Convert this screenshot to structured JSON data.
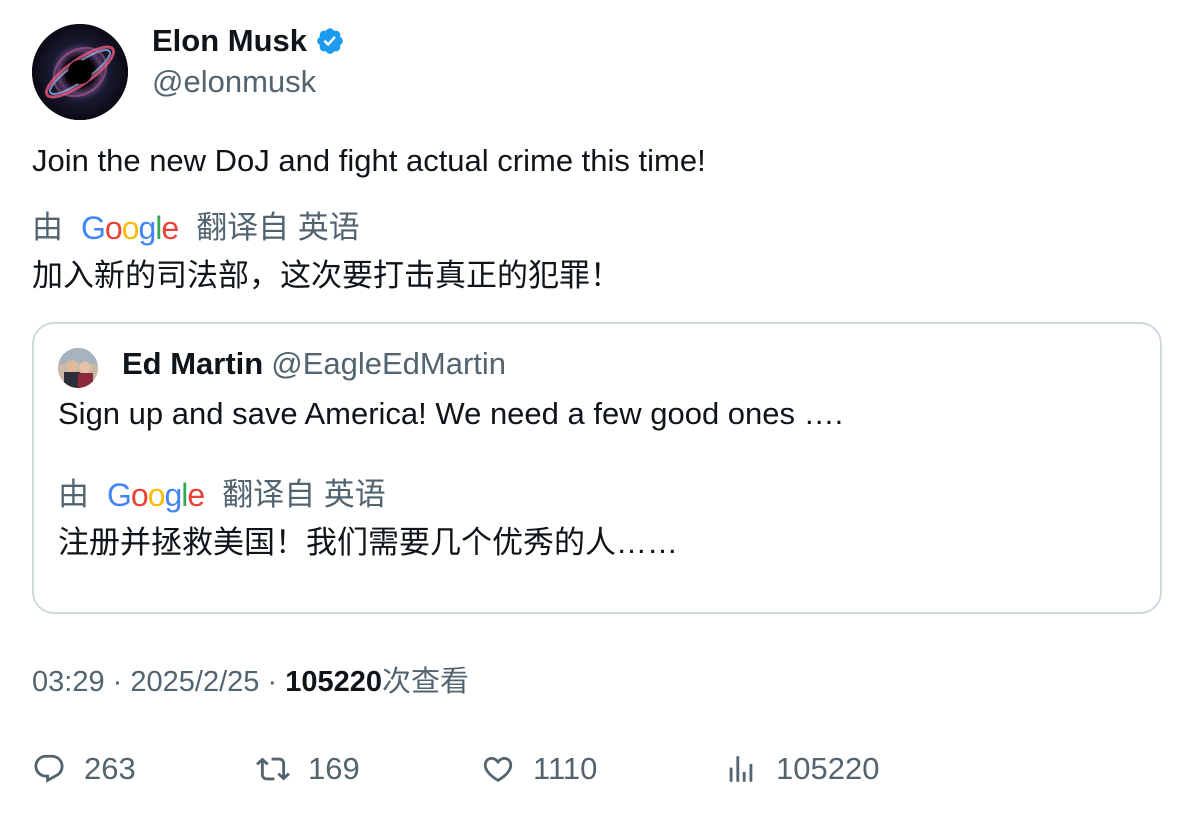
{
  "author": {
    "name": "Elon Musk",
    "handle": "@elonmusk",
    "verified": true
  },
  "tweet": {
    "text": "Join the new DoJ and fight actual crime this time!",
    "translation": {
      "prefix": "由",
      "provider": "Google",
      "source_label": "翻译自 英语",
      "text": "加入新的司法部，这次要打击真正的犯罪！"
    }
  },
  "quote": {
    "name": "Ed Martin",
    "handle": "@EagleEdMartin",
    "text": "Sign up and save America!  We need a few good ones ….",
    "translation": {
      "prefix": "由",
      "provider": "Google",
      "source_label": "翻译自 英语",
      "text": "注册并拯救美国！我们需要几个优秀的人……"
    }
  },
  "meta": {
    "time": "03:29",
    "separator": "·",
    "date": "2025/2/25",
    "views_count": "105220",
    "views_label": "次查看"
  },
  "actions": {
    "replies": "263",
    "retweets": "169",
    "likes": "1110",
    "views": "105220"
  },
  "colors": {
    "verified_blue": "#1d9bf0",
    "muted_text": "#536471",
    "border": "#cfd9de"
  }
}
